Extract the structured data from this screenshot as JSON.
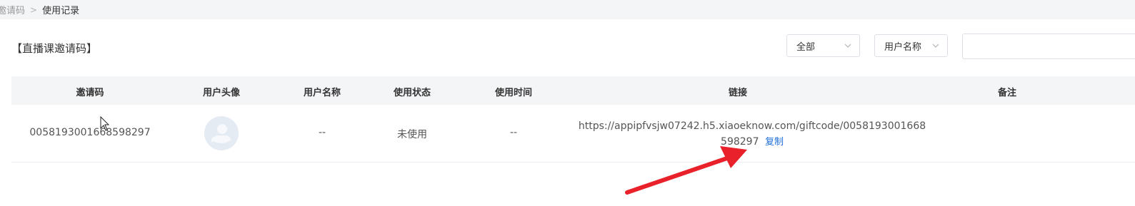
{
  "breadcrumb": {
    "parent": "邀请码",
    "separator": ">",
    "current": "使用记录"
  },
  "title": "【直播课邀请码】",
  "filters": {
    "status_select": "全部",
    "field_select": "用户名称",
    "search_value": ""
  },
  "table": {
    "headers": [
      "邀请码",
      "用户头像",
      "用户名称",
      "使用状态",
      "使用时间",
      "链接",
      "备注"
    ],
    "rows": [
      {
        "code": "0058193001668598297",
        "username": "--",
        "status": "未使用",
        "time": "--",
        "link_line1": "https://appipfvsjw07242.h5.xiaoeknow.com/giftcode/0058193001668",
        "link_line2": "598297",
        "copy_label": "复制",
        "remark": ""
      }
    ]
  },
  "colors": {
    "link_blue": "#1e6fd9",
    "arrow_red": "#e8212a",
    "header_bg": "#f4f5f7"
  },
  "icons": [
    "chevron-down-icon",
    "avatar-placeholder-icon",
    "mouse-cursor-icon",
    "red-arrow-annotation"
  ]
}
